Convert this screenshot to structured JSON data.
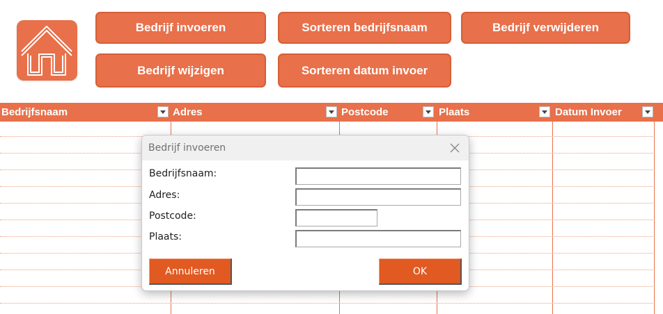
{
  "colors": {
    "accent": "#e8704a",
    "dialog_button": "#e15a22"
  },
  "home": {
    "icon": "home-icon"
  },
  "actions": {
    "bedrijf_invoeren": "Bedrijf invoeren",
    "sorteren_bedrijfsnaam": "Sorteren bedrijfsnaam",
    "bedrijf_verwijderen": "Bedrijf verwijderen",
    "bedrijf_wijzigen": "Bedrijf wijzigen",
    "sorteren_datum": "Sorteren datum invoer"
  },
  "table": {
    "columns": [
      "Bedrijfsnaam",
      "Adres",
      "Postcode",
      "Plaats",
      "Datum Invoer"
    ]
  },
  "dialog": {
    "title": "Bedrijf invoeren",
    "fields": [
      {
        "label": "Bedrijfsnaam:",
        "value": ""
      },
      {
        "label": "Adres:",
        "value": ""
      },
      {
        "label": "Postcode:",
        "value": ""
      },
      {
        "label": "Plaats:",
        "value": ""
      }
    ],
    "cancel_label": "Annuleren",
    "ok_label": "OK"
  }
}
